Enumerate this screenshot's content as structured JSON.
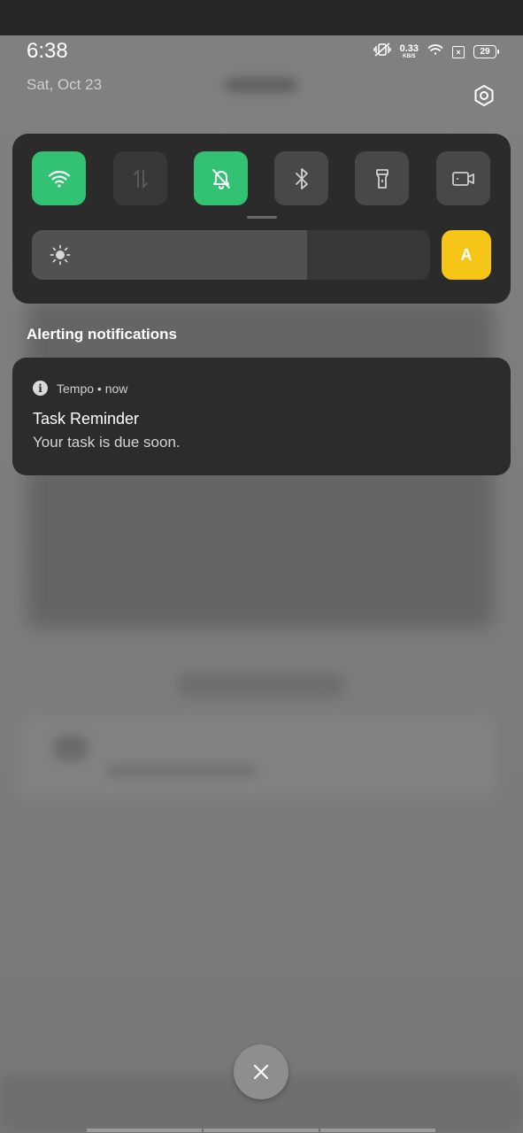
{
  "status_bar": {
    "time": "6:38",
    "net_speed_value": "0.33",
    "net_speed_unit": "KB/S",
    "battery_level": "29",
    "sim_icon_text": "×"
  },
  "shade": {
    "date": "Sat, Oct 23"
  },
  "quick_settings": {
    "tiles": [
      {
        "name": "wifi",
        "icon": "wifi-icon",
        "state": "on"
      },
      {
        "name": "mobile-data",
        "icon": "mobile-data-icon",
        "state": "unavailable"
      },
      {
        "name": "silent",
        "icon": "bell-off-icon",
        "state": "on"
      },
      {
        "name": "bluetooth",
        "icon": "bluetooth-icon",
        "state": "off"
      },
      {
        "name": "flashlight",
        "icon": "flashlight-icon",
        "state": "off"
      },
      {
        "name": "screen-record",
        "icon": "video-camera-icon",
        "state": "off"
      }
    ],
    "brightness_level": 0.69,
    "auto_brightness_label": "A",
    "active_color": "#33c173",
    "auto_color": "#f5c518"
  },
  "notifications": {
    "section_label": "Alerting notifications",
    "items": [
      {
        "app_name": "Tempo",
        "separator": "•",
        "time": "now",
        "title": "Task Reminder",
        "body": "Your task is due soon."
      }
    ]
  },
  "clear_button": {
    "icon": "close-icon"
  }
}
